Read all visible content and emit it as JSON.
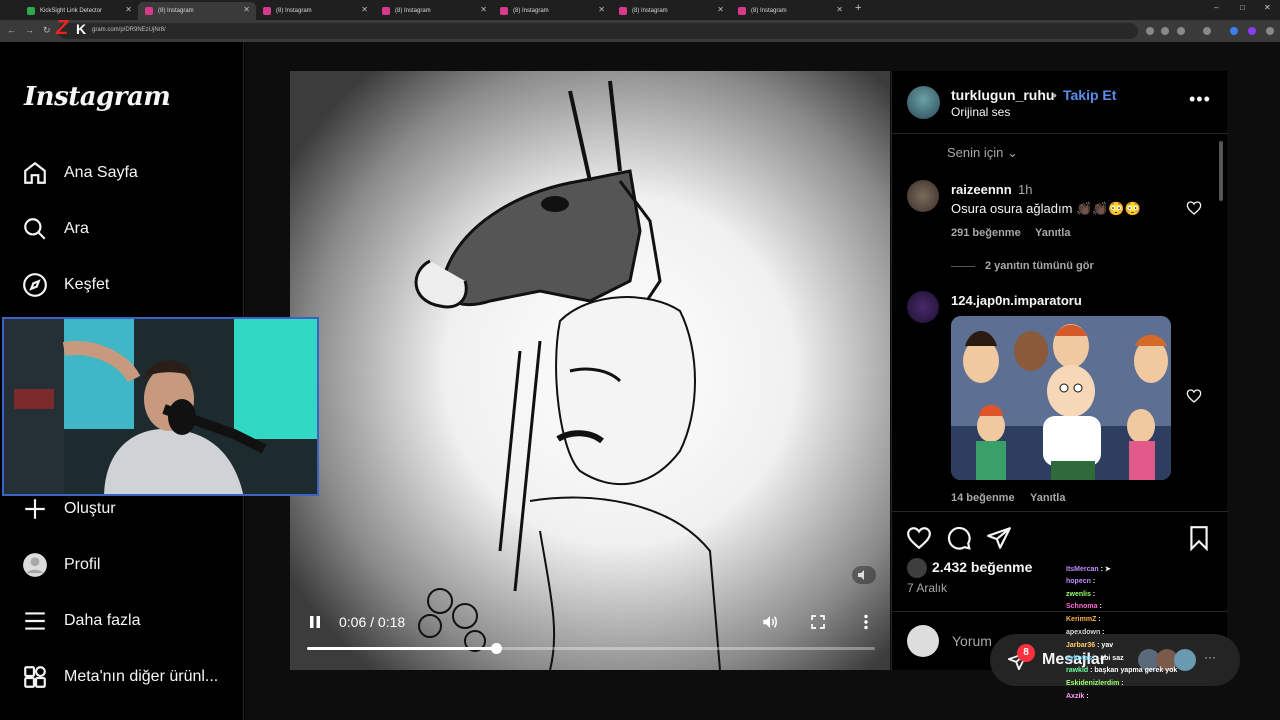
{
  "browser": {
    "tabs": [
      {
        "title": "KickSight Link Detector",
        "active": false
      },
      {
        "title": "(8) Instagram",
        "active": true
      },
      {
        "title": "(8) Instagram",
        "active": false
      },
      {
        "title": "(8) Instagram",
        "active": false
      },
      {
        "title": "(8) Instagram",
        "active": false
      },
      {
        "title": "(8) Instagram",
        "active": false
      },
      {
        "title": "(8) Instagram",
        "active": false
      }
    ],
    "url": "gram.com/p/DR9NEzUjNr8/",
    "new_tab_glyph": "+",
    "window_controls": [
      "–",
      "□",
      "✕"
    ]
  },
  "sidebar": {
    "logo": "Instagram",
    "items": [
      {
        "label": "Ana Sayfa",
        "icon": "home-icon"
      },
      {
        "label": "Ara",
        "icon": "search-icon"
      },
      {
        "label": "Keşfet",
        "icon": "compass-icon"
      },
      {
        "label": "Oluştur",
        "icon": "plus-icon"
      },
      {
        "label": "Profil",
        "icon": "profile-icon"
      },
      {
        "label": "Daha fazla",
        "icon": "menu-icon"
      },
      {
        "label": "Meta'nın diğer ürünl...",
        "icon": "apps-icon"
      }
    ]
  },
  "video": {
    "time": "0:06 / 0:18",
    "progress": 0.333,
    "playing": true
  },
  "post": {
    "username": "turklugun_ruhu",
    "separator": "•",
    "follow_label": "Takip Et",
    "audio": "Orijinal ses",
    "more": "•••",
    "sort_label": "Senin için",
    "comments": [
      {
        "username": "raizeennn",
        "time": "1h",
        "text": "Osura osura ağladım 👏🏿👏🏿😳😳",
        "likes": "291 beğenme",
        "reply": "Yanıtla",
        "view_replies": "2 yanıtın tümünü gör"
      },
      {
        "username": "124.jap0n.imparatoru",
        "likes": "14 beğenme",
        "reply": "Yanıtla"
      }
    ],
    "like_count": "2.432 beğenme",
    "date": "7 Aralık",
    "comment_placeholder": "Yorum"
  },
  "messages": {
    "label": "Mesajlar",
    "badge": "8",
    "more": "···"
  },
  "chat": [
    {
      "user": "ItsMercan",
      "msg": ": ➤",
      "color": "#c48cff"
    },
    {
      "user": "hopecn",
      "msg": ":",
      "color": "#c48cff"
    },
    {
      "user": "zwenlis",
      "msg": ":",
      "color": "#9cff6b"
    },
    {
      "user": "Schnoma",
      "msg": ":",
      "color": "#ff6bd5"
    },
    {
      "user": "KerimmZ",
      "msg": ":",
      "color": "#ffb347"
    },
    {
      "user": "apexdown",
      "msg": ":",
      "color": "#e0e0e0"
    },
    {
      "user": "Jarbar36",
      "msg": ": yav",
      "color": "#ffcc66"
    },
    {
      "user": "eykotasi",
      "msg": ": abi saz",
      "color": "#7ad7ff"
    },
    {
      "user": "rawkid",
      "msg": ": başkan yapma gerek yok",
      "color": "#6bff9c"
    },
    {
      "user": "Eskidenizlerdim",
      "msg": ":",
      "color": "#9cff6b"
    },
    {
      "user": "Axzik",
      "msg": ":",
      "color": "#ff9cf0"
    }
  ]
}
